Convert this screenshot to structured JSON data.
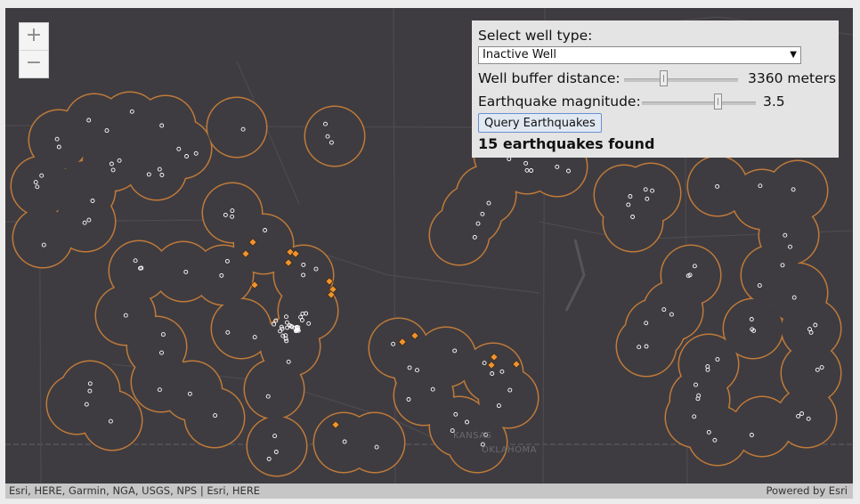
{
  "map": {
    "state_labels": [
      "KANSAS",
      "OKLAHOMA"
    ],
    "zoom_in_label": "+",
    "zoom_out_label": "−",
    "buffer_color": "#c07a3a",
    "earthquake_color": "#f0922e",
    "well_color": "#ffffff",
    "base_color": "#3e3c40"
  },
  "panel": {
    "well_type_label": "Select well type:",
    "well_type_value": "Inactive Well",
    "buffer_label": "Well buffer distance:",
    "buffer_value": "3360 meters",
    "buffer_fraction": 0.34,
    "magnitude_label": "Earthquake magnitude:",
    "magnitude_value": "3.5",
    "magnitude_fraction": 0.68,
    "query_button": "Query Earthquakes",
    "result_text": "15 earthquakes found"
  },
  "attribution": {
    "sources": "Esri, HERE, Garmin, NGA, USGS, NPS | Esri, HERE",
    "powered_by": "Powered by Esri"
  }
}
